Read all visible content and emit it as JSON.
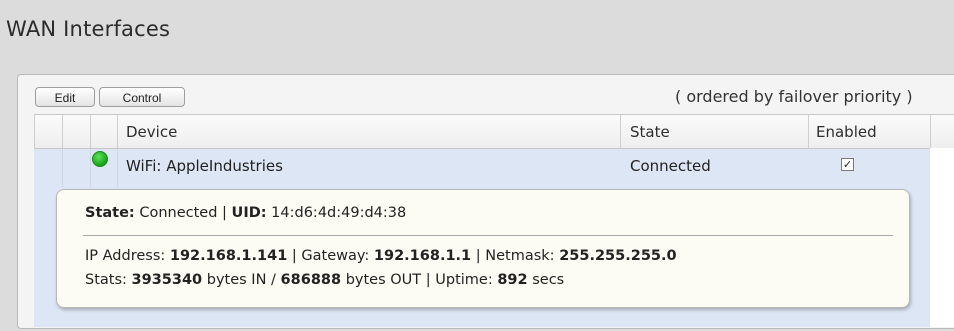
{
  "page": {
    "title": "WAN Interfaces"
  },
  "toolbar": {
    "edit_label": "Edit",
    "control_label": "Control",
    "order_note": "( ordered by failover priority )"
  },
  "table": {
    "columns": [
      "Device",
      "State",
      "Enabled"
    ],
    "rows": [
      {
        "status_icon": "green-dot-icon",
        "status_color": "#1aa51a",
        "device": "WiFi: AppleIndustries",
        "state": "Connected",
        "enabled": true,
        "enabled_glyph": "✓"
      }
    ]
  },
  "details": {
    "state_label": "State:",
    "state_value": "Connected",
    "uid_label": "UID:",
    "uid_value": "14:d6:4d:49:d4:38",
    "sep": "|",
    "ip_label": "IP Address:",
    "ip_value": "192.168.1.141",
    "gateway_label": "Gateway:",
    "gateway_value": "192.168.1.1",
    "netmask_label": "Netmask:",
    "netmask_value": "255.255.255.0",
    "stats_label": "Stats:",
    "bytes_in": "3935340",
    "bytes_in_suffix": "bytes IN /",
    "bytes_out": "686888",
    "bytes_out_suffix": "bytes OUT",
    "uptime_label": "Uptime:",
    "uptime_value": "892",
    "uptime_unit": "secs"
  },
  "colors": {
    "row_selected": "#dde6f5",
    "detail_bg": "#fdfcf4"
  }
}
